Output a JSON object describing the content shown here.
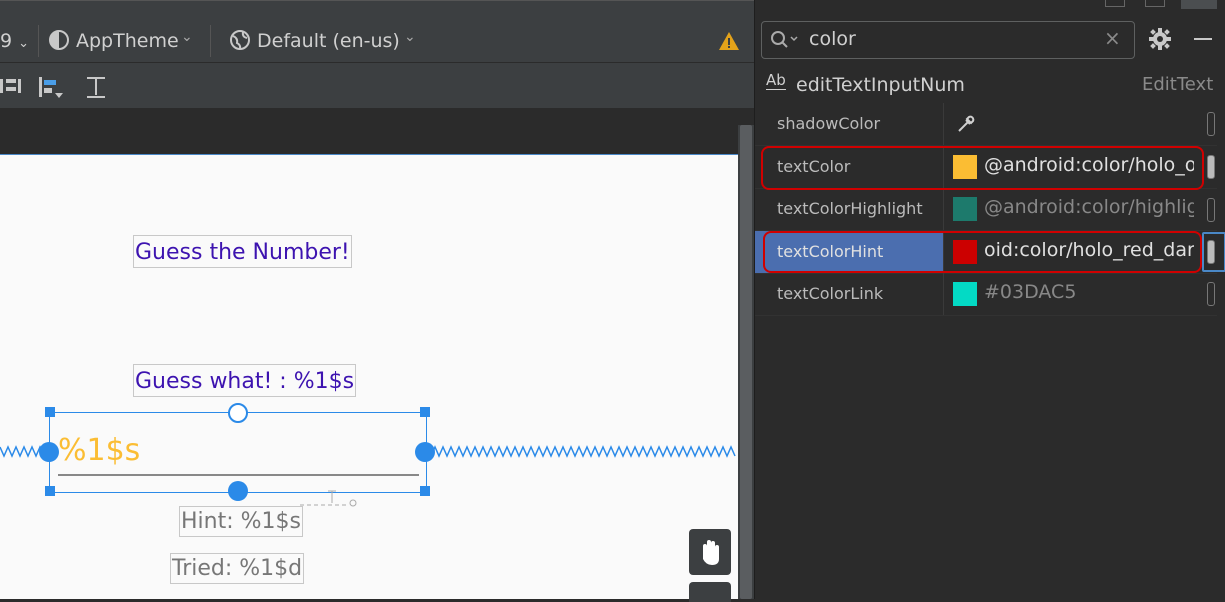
{
  "toolbar": {
    "api_fragment": "9",
    "theme_label": "AppTheme",
    "locale_label": "Default (en-us)"
  },
  "canvas": {
    "title_text": "Guess the Number!",
    "guess_text": "Guess what! : %1$s",
    "input_hint": "%1$s",
    "hint_text": "Hint: %1$s",
    "tried_text": "Tried: %1$d",
    "colors": {
      "title": "#3d13b0",
      "hint_color": "#fbbd33",
      "gray_text": "#777777"
    }
  },
  "attributes": {
    "search_value": "color",
    "component_id": "editTextInputNum",
    "component_type": "EditText",
    "rows": [
      {
        "name": "shadowColor",
        "value": "",
        "swatch": ""
      },
      {
        "name": "textColor",
        "value": "@android:color/holo_o",
        "swatch": "#fbbd33"
      },
      {
        "name": "textColorHighlight",
        "value": "@android:color/highlig",
        "swatch": "#1d7a6c"
      },
      {
        "name": "textColorHint",
        "value": "oid:color/holo_red_dark",
        "swatch": "#cc0000"
      },
      {
        "name": "textColorLink",
        "value": "#03DAC5",
        "swatch": "#03dac5"
      }
    ]
  }
}
